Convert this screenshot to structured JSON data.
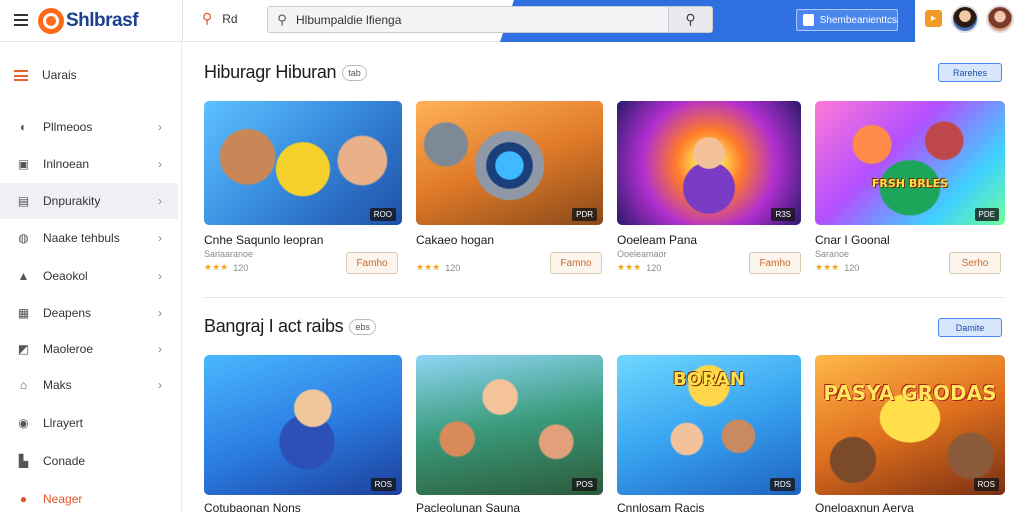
{
  "header": {
    "logo_text": "Shlbrasf",
    "search_small_label": "Rd",
    "search_value": "Hlbumpaldie lfienga",
    "promo_label": "Shembeanienttcs",
    "accent_color": "#2f6fe0",
    "brand_color": "#ff6a1a"
  },
  "sidebar": {
    "heading": "Uarais",
    "items": [
      {
        "label": "Pllmeoos",
        "icon": "game-icon"
      },
      {
        "label": "Inlnoean",
        "icon": "image-icon"
      },
      {
        "label": "Dnpurakity",
        "icon": "card-icon"
      },
      {
        "label": "Naake tehbuls",
        "icon": "shield-icon"
      },
      {
        "label": "Oeaokol",
        "icon": "lock-icon"
      },
      {
        "label": "Deapens",
        "icon": "list-icon"
      },
      {
        "label": "Maoleroe",
        "icon": "chart-icon"
      },
      {
        "label": "Maks",
        "icon": "home-icon"
      },
      {
        "label": "Llrayert",
        "icon": "circle-icon"
      },
      {
        "label": "Conade",
        "icon": "bag-icon"
      },
      {
        "label": "Neager",
        "icon": "fire-icon"
      }
    ]
  },
  "sections": [
    {
      "title": "Hiburagr Hiburan",
      "chip": "tab",
      "button": "Rarehes",
      "cards": [
        {
          "title": "Cnhe Saqunlo leopran",
          "meta": "Sarlaaranoe",
          "stars": "★★★",
          "count": "120",
          "badge": "ROO",
          "button": "Famho"
        },
        {
          "title": "Cakaeo hogan",
          "meta": "",
          "stars": "★★★",
          "count": "120",
          "badge": "PDR",
          "button": "Famno",
          "art_text": ""
        },
        {
          "title": "Ooeleam Pana",
          "meta": "Ooeleamaor",
          "stars": "★★★",
          "count": "120",
          "badge": "R3S",
          "button": "Famho",
          "art_text": ""
        },
        {
          "title": "Cnar I Goonal",
          "meta": "Saranoe",
          "stars": "★★★",
          "count": "120",
          "badge": "PDE",
          "button": "Serho",
          "art_text": "FRSH BRLES"
        }
      ]
    },
    {
      "title": "Bangraj  I act raibs",
      "chip": "ebs",
      "button": "Damite",
      "cards": [
        {
          "title": "Cotubaonan Nons",
          "badge": "ROS",
          "art_text": ""
        },
        {
          "title": "Pacleolunan Sauna",
          "badge": "POS",
          "art_text": ""
        },
        {
          "title": "Cnnlosam Racis",
          "badge": "RDS",
          "art_text": "BORAN"
        },
        {
          "title": "Oneloaxnun Aerva",
          "badge": "ROS",
          "art_text": "PASYA GRODAS"
        }
      ]
    }
  ]
}
